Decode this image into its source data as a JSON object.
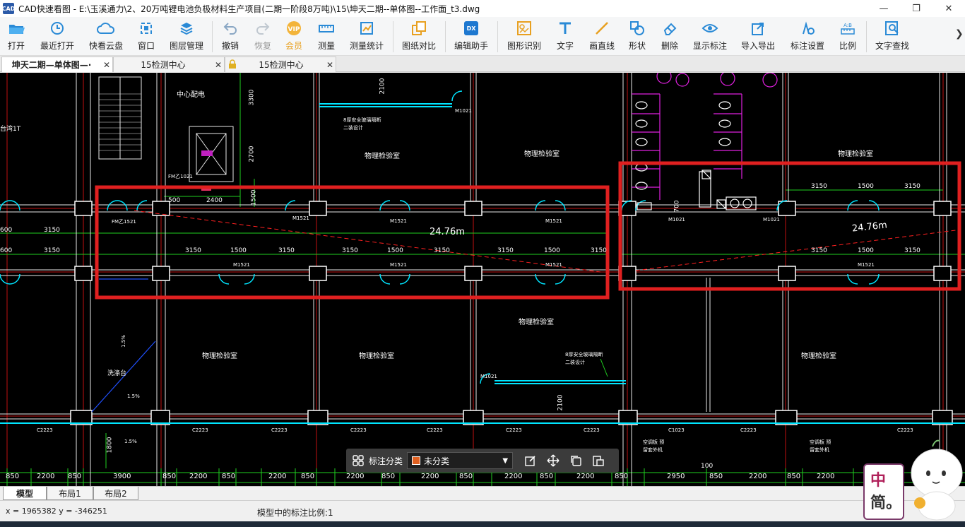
{
  "window": {
    "app_icon_text": "CAD",
    "title": "CAD快速看图 - E:\\玉溪通力\\2、20万吨锂电池负极材料生产项目(二期一阶段8万吨)\\15\\坤天二期--单体图--工作面_t3.dwg",
    "minimize": "—",
    "maximize": "❐",
    "close": "✕"
  },
  "toolbar": {
    "items": [
      {
        "label": "打开",
        "icon": "folder-open-icon"
      },
      {
        "label": "最近打开",
        "icon": "history-icon"
      },
      {
        "label": "快看云盘",
        "icon": "cloud-icon"
      },
      {
        "label": "窗口",
        "icon": "window-icon"
      },
      {
        "label": "图层管理",
        "icon": "layers-icon"
      },
      {
        "label": "撤销",
        "icon": "undo-icon"
      },
      {
        "label": "恢复",
        "icon": "redo-icon"
      },
      {
        "label": "会员",
        "icon": "vip-icon"
      },
      {
        "label": "测量",
        "icon": "ruler-icon"
      },
      {
        "label": "测量统计",
        "icon": "measure-stats-icon"
      },
      {
        "label": "图纸对比",
        "icon": "compare-icon"
      },
      {
        "label": "编辑助手",
        "icon": "edit-assistant-icon"
      },
      {
        "label": "图形识别",
        "icon": "shape-recognize-icon"
      },
      {
        "label": "文字",
        "icon": "text-icon"
      },
      {
        "label": "画直线",
        "icon": "line-icon"
      },
      {
        "label": "形状",
        "icon": "shapes-icon"
      },
      {
        "label": "删除",
        "icon": "eraser-icon"
      },
      {
        "label": "显示标注",
        "icon": "eye-icon"
      },
      {
        "label": "导入导出",
        "icon": "import-export-icon"
      },
      {
        "label": "标注设置",
        "icon": "annotation-settings-icon"
      },
      {
        "label": "比例",
        "icon": "scale-icon"
      },
      {
        "label": "文字查找",
        "icon": "text-search-icon"
      }
    ],
    "more": "❯"
  },
  "tabs": [
    {
      "label": "坤天二期--单体图--工作面_t3",
      "display": "坤天二期—单体图—·",
      "close": "✕"
    },
    {
      "label": "15检测中心",
      "close": "✕"
    },
    {
      "label": "15检测中心",
      "close": "✕"
    }
  ],
  "drawing": {
    "rooms": [
      "中心配电",
      "物理检验室",
      "物理检验室",
      "物理检验室",
      "物理检验室",
      "物理检验室",
      "物理检验室",
      "物理检验室",
      "物理检验室"
    ],
    "measure_left": "24.76m",
    "measure_right": "24.76m",
    "dims_row1": [
      "500",
      "2400",
      "1500",
      "3150",
      "1500",
      "3150"
    ],
    "dims_row2": [
      "3150",
      "1500",
      "3150",
      "3150",
      "1500",
      "3150",
      "3150",
      "1500",
      "3150"
    ],
    "dims_left": [
      "600",
      "3150",
      "600",
      "3150"
    ],
    "dims_vertical": [
      "3300",
      "2700",
      "2100",
      "2100",
      "1500",
      "700",
      "1800"
    ],
    "door_tags": [
      "FM乙1521",
      "M1521",
      "M1521",
      "M1521",
      "M1521",
      "M1021",
      "M1021",
      "M1521",
      "M1521",
      "M1521",
      "M1021",
      "FM乙1021",
      "M1021"
    ],
    "window_tags": [
      "C2223",
      "C2223",
      "C2223",
      "C2223",
      "C2223",
      "C2223",
      "C2223",
      "C1023",
      "C2223",
      "C2223"
    ],
    "notes": [
      "8厚安全玻璃隔断 二装设计",
      "8厚安全玻璃隔断 二装设计",
      "洗涤台",
      "空调板 预留套外机",
      "空调板 预留套外机",
      "1.5%",
      "1.5%",
      "1.5%",
      "100",
      "台湾1T"
    ],
    "bottom_dims": [
      "850",
      "2200",
      "850",
      "3900",
      "850",
      "2200",
      "850",
      "2200",
      "850",
      "2200",
      "850",
      "2200",
      "850",
      "2200",
      "850",
      "2200",
      "850",
      "2950",
      "850",
      "2200",
      "850",
      "2200"
    ]
  },
  "annotation_bar": {
    "label": "标注分类",
    "selected": "未分类",
    "swatch_color": "#e06020"
  },
  "layout_tabs": [
    "模型",
    "布局1",
    "布局2"
  ],
  "status": {
    "coords": "x = 1965382  y = -346251",
    "scale": "模型中的标注比例:1"
  },
  "ime": {
    "char1": "中",
    "char2": "简。"
  },
  "colors": {
    "highlight_box": "#e02020",
    "canvas_bg": "#000000",
    "wall": "#ffffff",
    "door": "#00e5ff",
    "dim": "#00ff00"
  }
}
